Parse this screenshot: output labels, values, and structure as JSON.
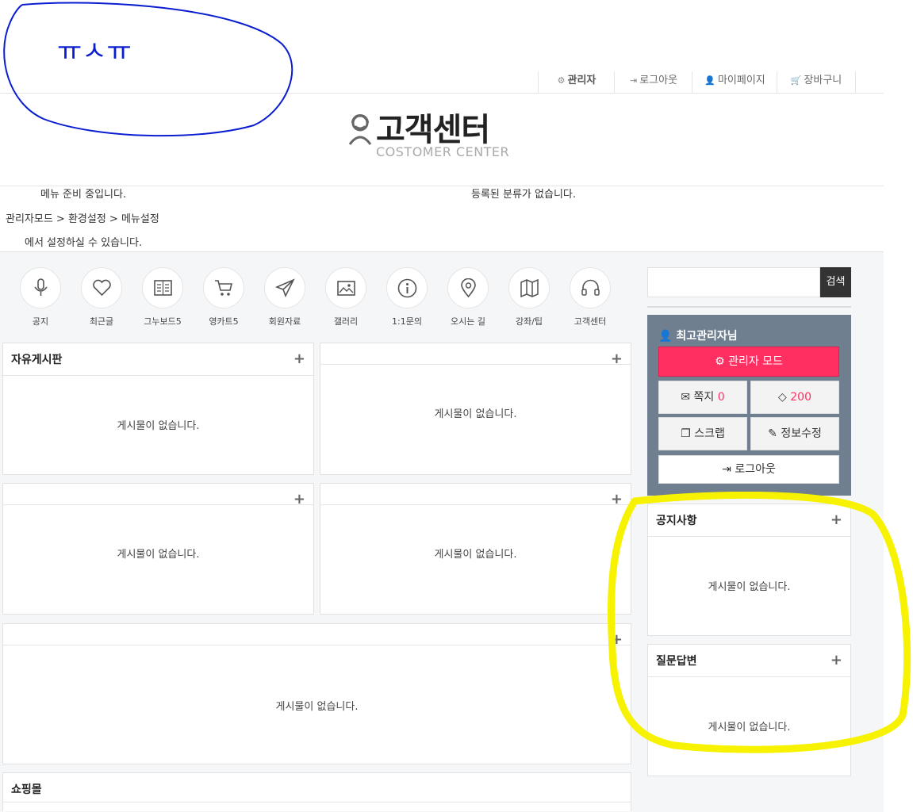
{
  "header": {
    "links": [
      {
        "label": "관리자",
        "icon": "gear-icon"
      },
      {
        "label": "로그아웃",
        "icon": "sign-out-icon"
      },
      {
        "label": "마이페이지",
        "icon": "user-icon"
      },
      {
        "label": "장바구니",
        "icon": "cart-icon"
      }
    ],
    "logo_title": "고객센터",
    "logo_subtitle": "COSTOMER CENTER"
  },
  "menu": {
    "preparing": "메뉴 준비 중입니다.",
    "no_category": "등록된 분류가 없습니다.",
    "path": "관리자모드 > 환경설정 > 메뉴설정",
    "hint": "에서 설정하실 수 있습니다."
  },
  "quick_icons": [
    {
      "label": "공지",
      "icon": "microphone-icon"
    },
    {
      "label": "최근글",
      "icon": "heart-icon"
    },
    {
      "label": "그누보드5",
      "icon": "book-icon"
    },
    {
      "label": "영카트5",
      "icon": "cart-icon"
    },
    {
      "label": "회원자료",
      "icon": "paper-plane-icon"
    },
    {
      "label": "갤러리",
      "icon": "image-icon"
    },
    {
      "label": "1:1문의",
      "icon": "info-icon"
    },
    {
      "label": "오시는 길",
      "icon": "map-marker-icon"
    },
    {
      "label": "강좌/팁",
      "icon": "map-icon"
    },
    {
      "label": "고객센터",
      "icon": "headset-icon"
    }
  ],
  "boards": {
    "free_title": "자유게시판",
    "shop_title": "쇼핑몰",
    "empty": "게시물이 없습니다.",
    "plus": "+"
  },
  "sidebar": {
    "search_button": "검색",
    "user_name": "최고관리자님",
    "admin_mode": "관리자 모드",
    "memo_label": "쪽지",
    "memo_count": "0",
    "point": "200",
    "scrap": "스크랩",
    "edit_info": "정보수정",
    "logout": "로그아웃",
    "notice_title": "공지사항",
    "qa_title": "질문답변"
  },
  "annotation": {
    "handwriting": "ㅠㅅㅠ",
    "blue": "#0a1ed0",
    "yellow": "#f7f200"
  }
}
